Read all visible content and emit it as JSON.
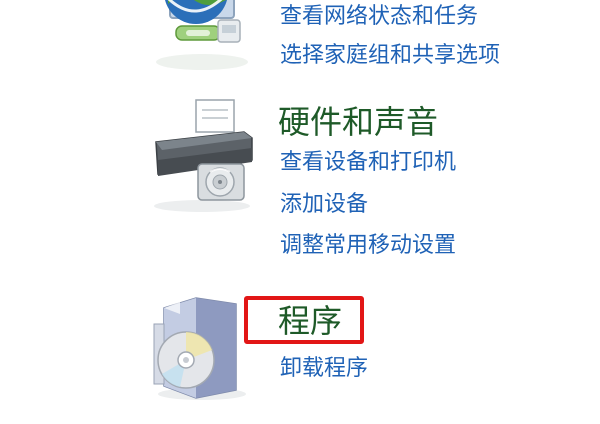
{
  "categories": {
    "network": {
      "icon": "network-globe-icon",
      "links": [
        "查看网络状态和任务",
        "选择家庭组和共享选项"
      ]
    },
    "hardware": {
      "icon": "printer-icon",
      "title": "硬件和声音",
      "links": [
        "查看设备和打印机",
        "添加设备",
        "调整常用移动设置"
      ]
    },
    "programs": {
      "icon": "program-disc-box-icon",
      "title": "程序",
      "links": [
        "卸载程序"
      ]
    }
  },
  "colors": {
    "title": "#1e5a28",
    "link": "#1f62b6",
    "highlight": "#e21616",
    "background": "#ffffff"
  }
}
